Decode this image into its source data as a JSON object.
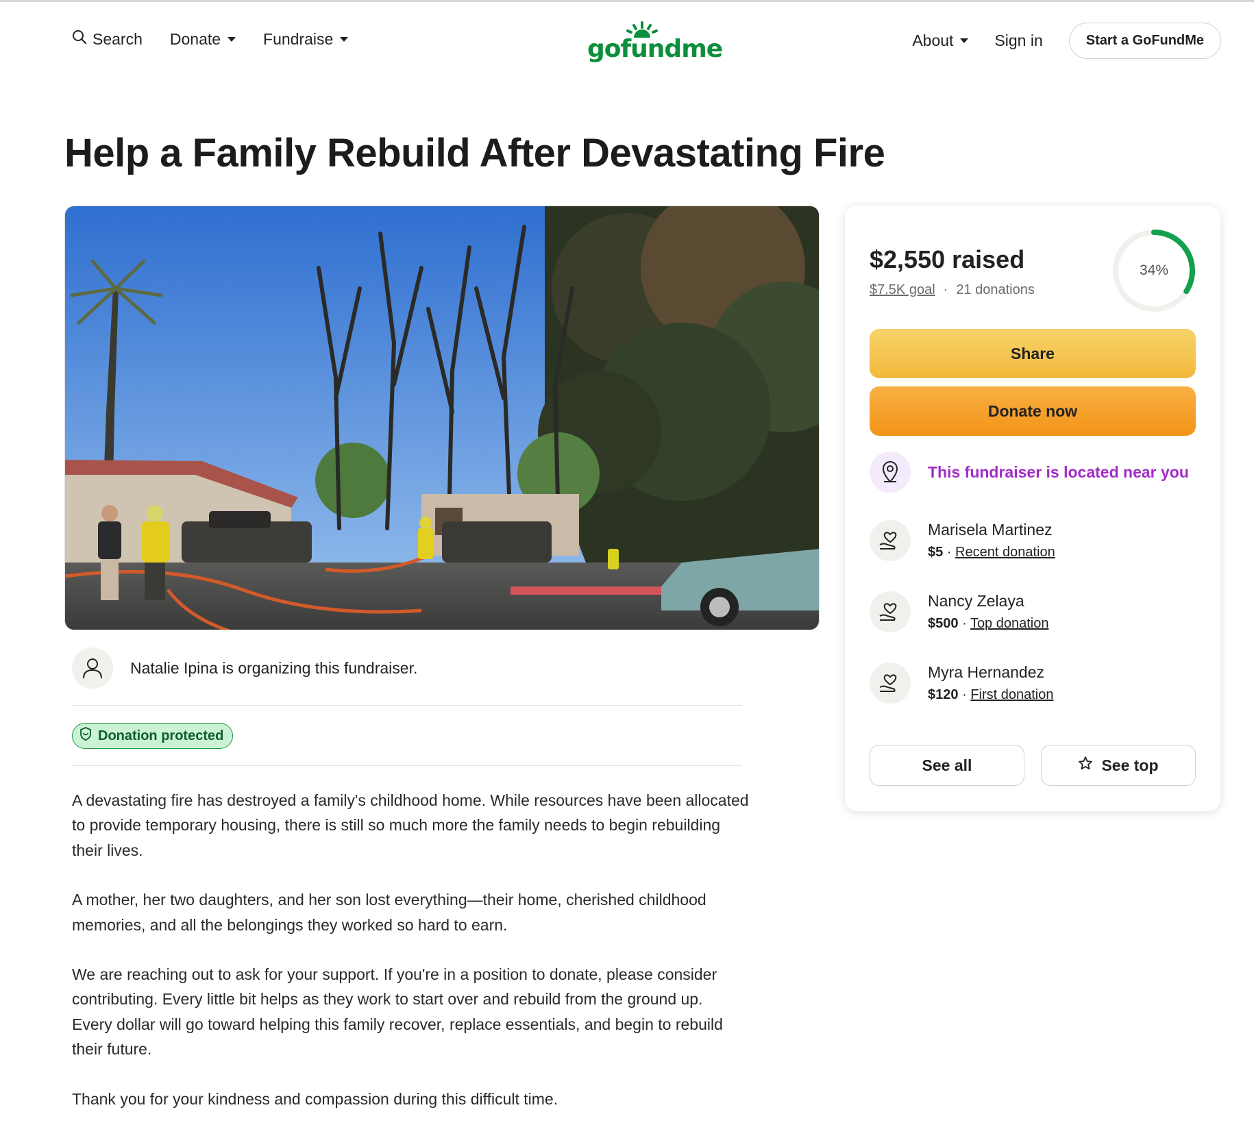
{
  "header": {
    "search_label": "Search",
    "donate_label": "Donate",
    "fundraise_label": "Fundraise",
    "logo_text": "gofundme",
    "about_label": "About",
    "signin_label": "Sign in",
    "start_label": "Start a GoFundMe"
  },
  "campaign": {
    "title": "Help a Family Rebuild After Devastating Fire",
    "organizer_text": "Natalie Ipina is organizing this fundraiser.",
    "protected_label": "Donation protected",
    "story": [
      "A devastating fire has destroyed a family's childhood home. While resources have been allocated to provide temporary housing, there is still so much more the family needs to begin rebuilding their lives.",
      "A mother, her two daughters, and her son lost everything—their home, cherished childhood memories, and all the belongings they worked so hard to earn.",
      "We are reaching out to ask for your support. If you're in a position to donate, please consider contributing. Every little bit helps as they work to start over and rebuild from the ground up.",
      "Every dollar will go toward helping this family recover, replace essentials, and begin to rebuild their future.",
      "Thank you for your kindness and compassion during this difficult time."
    ]
  },
  "sidebar": {
    "raised": "$2,550 raised",
    "goal": "$7.5K goal",
    "separator": "·",
    "donations": "21 donations",
    "progress_label": "34%",
    "progress_fraction": 0.34,
    "share_label": "Share",
    "donate_label": "Donate now",
    "near_text": "This fundraiser is located near you",
    "donors": [
      {
        "name": "Marisela Martinez",
        "amount": "$5",
        "tag": "Recent donation"
      },
      {
        "name": "Nancy Zelaya",
        "amount": "$500",
        "tag": "Top donation"
      },
      {
        "name": "Myra Hernandez",
        "amount": "$120",
        "tag": "First donation"
      }
    ],
    "see_all_label": "See all",
    "see_top_label": "See top"
  },
  "colors": {
    "brand_green": "#0b8f3a",
    "share_yellow": "#f2b93b",
    "donate_orange": "#f29418",
    "near_purple": "#a12bc9",
    "progress_green": "#13a04f"
  }
}
